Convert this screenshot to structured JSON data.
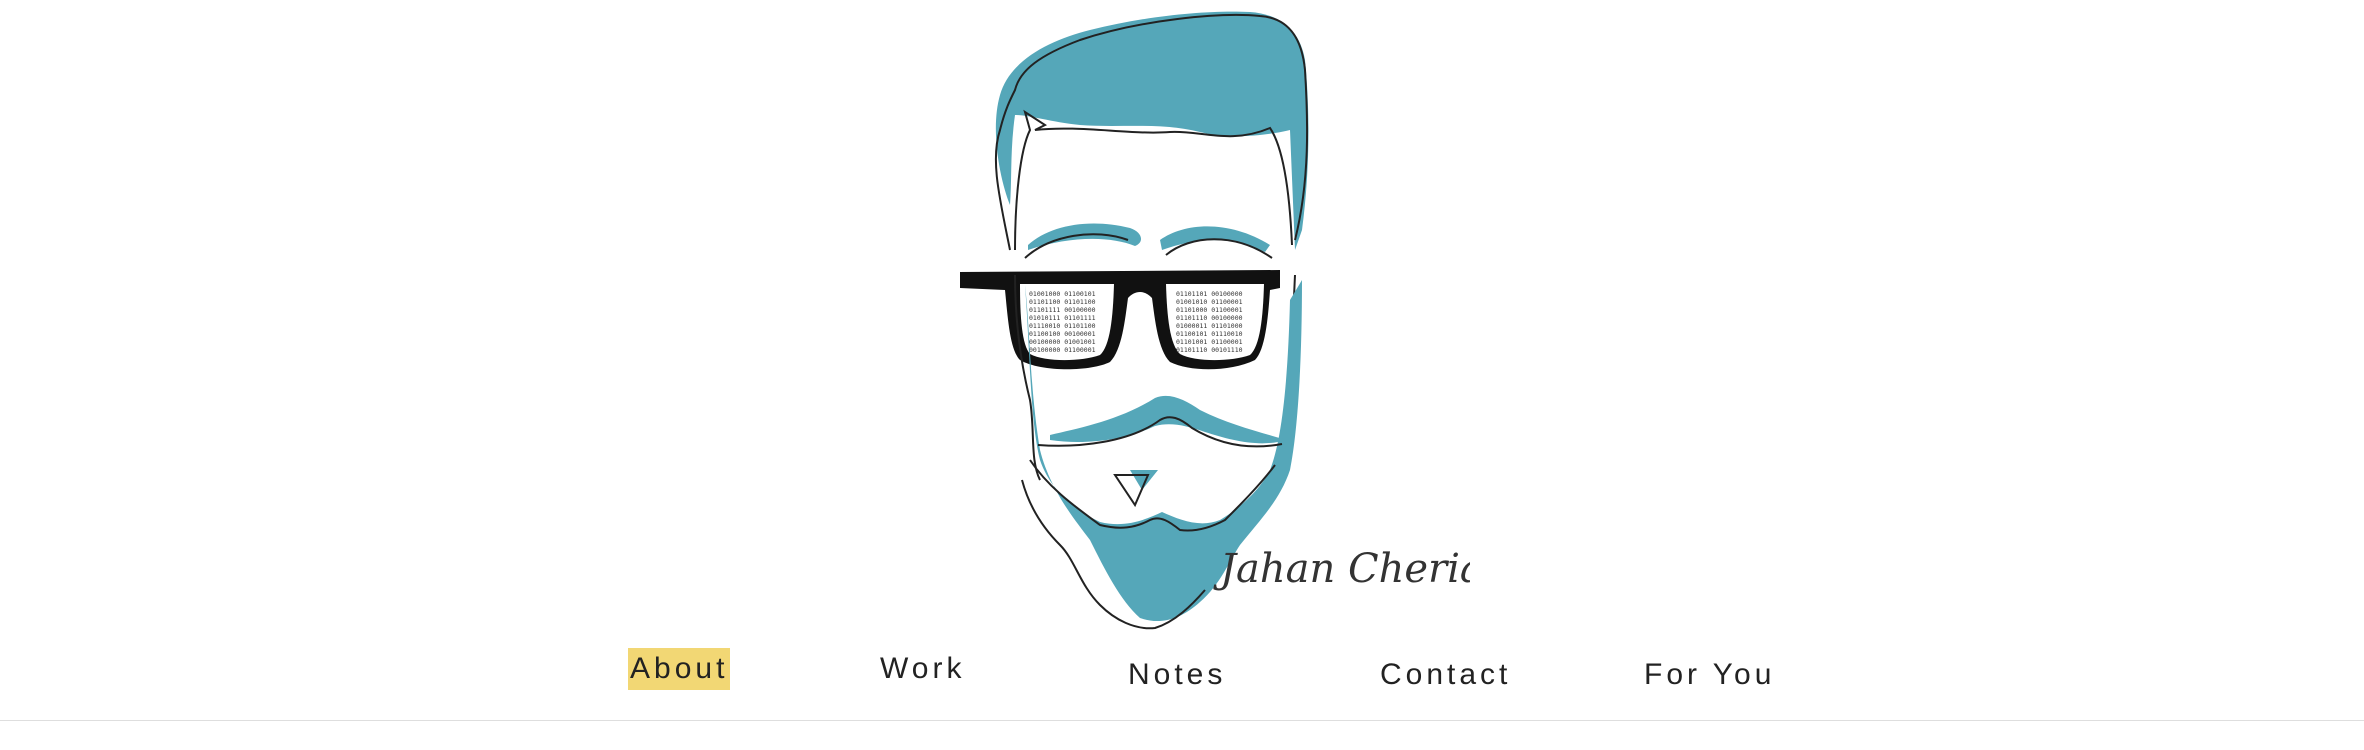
{
  "logo": {
    "name": "Jahan Cherian",
    "accent_color": "#55a7b9",
    "line_color": "#222222",
    "glasses_color": "#111111",
    "lens_binary_left": [
      "01001000 01100101",
      "01101100 01101100",
      "01101111 00100000",
      "01010111 01101111",
      "01110010 01101100",
      "01100100 00100001",
      "00100000 01001001",
      "00100000 01100001"
    ],
    "lens_binary_right": [
      "01101101 00100000",
      "01001010 01100001",
      "01101000 01100001",
      "01101110 00100000",
      "01000011 01101000",
      "01100101 01110010",
      "01101001 01100001",
      "01101110 00101110"
    ]
  },
  "nav": {
    "items": [
      {
        "label": "About",
        "active": true
      },
      {
        "label": "Work",
        "active": false
      },
      {
        "label": "Notes",
        "active": false
      },
      {
        "label": "Contact",
        "active": false
      },
      {
        "label": "For You",
        "active": false
      }
    ],
    "highlight_color": "#f2d774"
  }
}
